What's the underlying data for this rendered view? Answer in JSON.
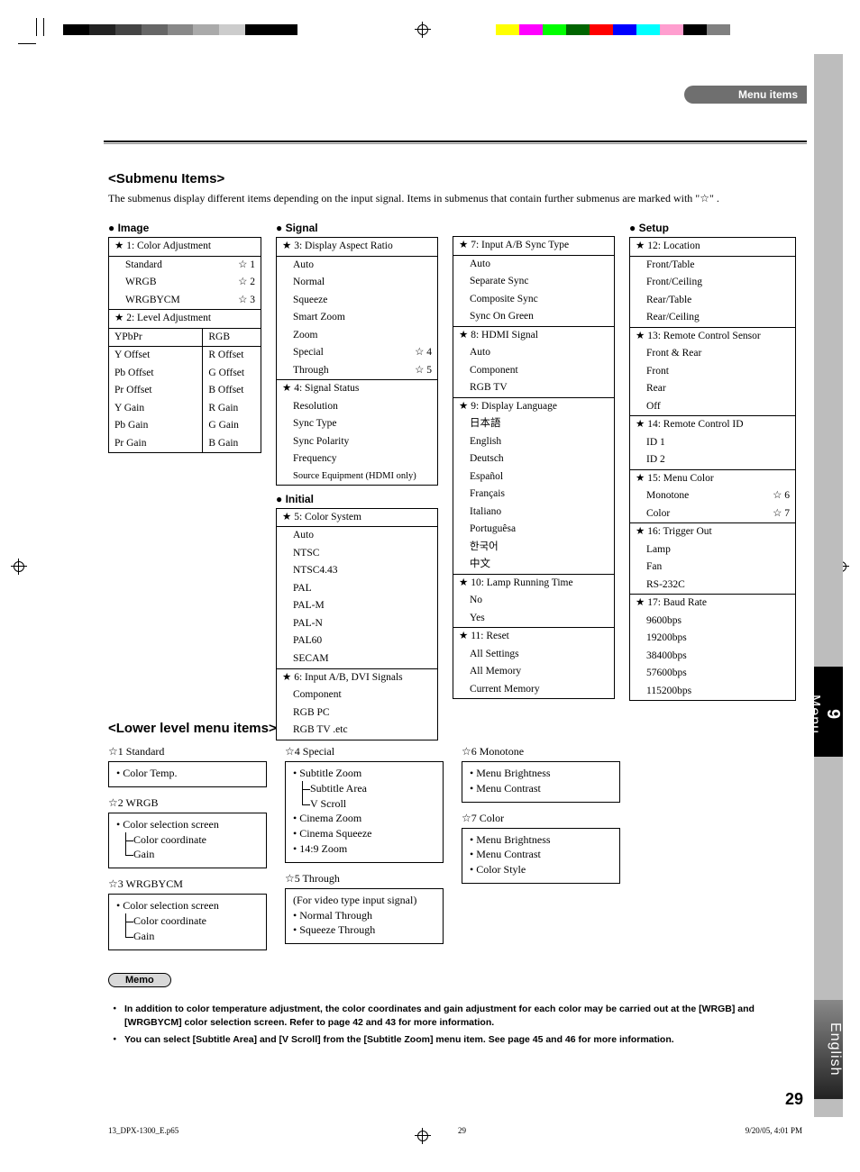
{
  "header": {
    "section": "Menu items"
  },
  "chapterTab": {
    "num": "9",
    "label": "Menu"
  },
  "langTab": "English",
  "submenu": {
    "title": "<Submenu Items>",
    "desc_a": "The submenus display different items depending on the input signal. Items in submenus that contain further submenus are marked with \"",
    "desc_star": "☆",
    "desc_b": "\" ."
  },
  "cat": {
    "image": "Image",
    "signal": "Signal",
    "initial": "Initial",
    "setup": "Setup"
  },
  "star": "★",
  "ostar": "☆",
  "image": {
    "h1": "1: Color Adjustment",
    "rows1": [
      {
        "l": "Standard",
        "m": "1"
      },
      {
        "l": "WRGB",
        "m": "2"
      },
      {
        "l": "WRGBYCM",
        "m": "3"
      }
    ],
    "h2": "2: Level Adjustment",
    "colA": "YPbPr",
    "colB": "RGB",
    "grid": [
      [
        "Y Offset",
        "R Offset"
      ],
      [
        "Pb Offset",
        "G Offset"
      ],
      [
        "Pr Offset",
        "B Offset"
      ],
      [
        "Y Gain",
        "R Gain"
      ],
      [
        "Pb Gain",
        "G Gain"
      ],
      [
        "Pr Gain",
        "B Gain"
      ]
    ]
  },
  "signal": {
    "h3": "3: Display Aspect Ratio",
    "items3": [
      "Auto",
      "Normal",
      "Squeeze",
      "Smart Zoom",
      "Zoom"
    ],
    "items3marked": [
      {
        "l": "Special",
        "m": "4"
      },
      {
        "l": "Through",
        "m": "5"
      }
    ],
    "h4": "4: Signal Status",
    "items4": [
      "Resolution",
      "Sync Type",
      "Sync Polarity",
      "Frequency",
      "Source Equipment (HDMI only)"
    ],
    "h5": "5: Color System",
    "items5": [
      "Auto",
      "NTSC",
      "NTSC4.43",
      "PAL",
      "PAL-M",
      "PAL-N",
      "PAL60",
      "SECAM"
    ],
    "h6": "6: Input A/B, DVI Signals",
    "items6": [
      "Component",
      "RGB PC",
      "RGB TV .etc"
    ],
    "h7": "7: Input A/B Sync Type",
    "items7": [
      "Auto",
      "Separate Sync",
      "Composite Sync",
      "Sync On Green"
    ],
    "h8": "8: HDMI Signal",
    "items8": [
      "Auto",
      "Component",
      "RGB TV"
    ],
    "h9": "9: Display Language",
    "items9": [
      "日本語",
      "English",
      "Deutsch",
      "Español",
      "Français",
      "Italiano",
      "Portuguêsa",
      "한국어",
      "中文"
    ],
    "h10": "10: Lamp Running Time",
    "items10": [
      "No",
      "Yes"
    ],
    "h11": "11: Reset",
    "items11": [
      "All Settings",
      "All Memory",
      "Current Memory"
    ]
  },
  "setup": {
    "h12": "12: Location",
    "items12": [
      "Front/Table",
      "Front/Ceiling",
      "Rear/Table",
      "Rear/Ceiling"
    ],
    "h13": "13: Remote Control Sensor",
    "items13": [
      "Front & Rear",
      "Front",
      "Rear",
      "Off"
    ],
    "h14": "14: Remote Control ID",
    "items14": [
      "ID 1",
      "ID 2"
    ],
    "h15": "15: Menu Color",
    "items15": [
      {
        "l": "Monotone",
        "m": "6"
      },
      {
        "l": "Color",
        "m": "7"
      }
    ],
    "h16": "16: Trigger Out",
    "items16": [
      "Lamp",
      "Fan",
      "RS-232C"
    ],
    "h17": "17: Baud Rate",
    "items17": [
      "9600bps",
      "19200bps",
      "38400bps",
      "57600bps",
      "115200bps"
    ]
  },
  "lower": {
    "title": "<Lower level menu items>",
    "b1": {
      "ttl": "1 Standard",
      "i0": "• Color Temp."
    },
    "b2": {
      "ttl": "2 WRGB",
      "i0": "• Color selection screen",
      "i1": "Color coordinate",
      "i2": "Gain"
    },
    "b3": {
      "ttl": "3 WRGBYCM",
      "i0": "• Color selection screen",
      "i1": "Color coordinate",
      "i2": "Gain"
    },
    "b4": {
      "ttl": "4 Special",
      "i0": "• Subtitle Zoom",
      "i1": "Subtitle Area",
      "i2": "V Scroll",
      "i3": "• Cinema Zoom",
      "i4": "• Cinema Squeeze",
      "i5": "• 14:9 Zoom"
    },
    "b5": {
      "ttl": "5 Through",
      "i0": "(For video type input signal)",
      "i1": "• Normal Through",
      "i2": "• Squeeze Through"
    },
    "b6": {
      "ttl": "6 Monotone",
      "i0": "• Menu Brightness",
      "i1": "• Menu Contrast"
    },
    "b7": {
      "ttl": "7 Color",
      "i0": "• Menu Brightness",
      "i1": "• Menu Contrast",
      "i2": "• Color Style"
    }
  },
  "memo": {
    "label": "Memo",
    "n1": "In addition to color temperature adjustment, the color coordinates and gain adjustment for each color may be carried out at the [WRGB] and [WRGBYCM] color selection screen. Refer to page 42 and 43 for more information.",
    "n2": "You can select [Subtitle Area] and [V Scroll] from the [Subtitle Zoom] menu item. See page 45 and 46 for more information."
  },
  "pagenum": "29",
  "footer": {
    "file": "13_DPX-1300_E.p65",
    "pg": "29",
    "date": "9/20/05, 4:01 PM"
  },
  "calib": {
    "left": [
      "#000",
      "#222",
      "#444",
      "#666",
      "#888",
      "#aaa",
      "#ccc",
      "#000",
      "#000"
    ],
    "right": [
      "#ffff00",
      "#ff00ff",
      "#00ff00",
      "#006400",
      "#ff0000",
      "#0000ff",
      "#00ffff",
      "#ff9ecf",
      "#000",
      "#808080"
    ]
  }
}
